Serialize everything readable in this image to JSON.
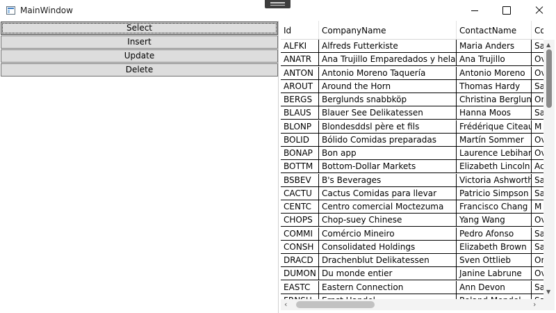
{
  "window": {
    "title": "MainWindow"
  },
  "buttons": [
    {
      "label": "Select"
    },
    {
      "label": "Insert"
    },
    {
      "label": "Update"
    },
    {
      "label": "Delete"
    }
  ],
  "grid": {
    "columns": [
      "Id",
      "CompanyName",
      "ContactName",
      "Co"
    ],
    "rows": [
      [
        "ALFKI",
        "Alfreds Futterkiste",
        "Maria Anders",
        "Sa"
      ],
      [
        "ANATR",
        "Ana Trujillo Emparedados y helados",
        "Ana Trujillo",
        "Ov"
      ],
      [
        "ANTON",
        "Antonio Moreno Taquería",
        "Antonio Moreno",
        "Ov"
      ],
      [
        "AROUT",
        "Around the Horn",
        "Thomas Hardy",
        "Sa"
      ],
      [
        "BERGS",
        "Berglunds snabbköp",
        "Christina Berglund",
        "Or"
      ],
      [
        "BLAUS",
        "Blauer See Delikatessen",
        "Hanna Moos",
        "Sa"
      ],
      [
        "BLONP",
        "Blondesddsl père et fils",
        "Frédérique Citeaux",
        "M"
      ],
      [
        "BOLID",
        "Bólido Comidas preparadas",
        "Martín Sommer",
        "Ov"
      ],
      [
        "BONAP",
        "Bon app",
        "Laurence Lebihan",
        "Ov"
      ],
      [
        "BOTTM",
        "Bottom-Dollar Markets",
        "Elizabeth Lincoln",
        "Ac"
      ],
      [
        "BSBEV",
        "B's Beverages",
        "Victoria Ashworth",
        "Sa"
      ],
      [
        "CACTU",
        "Cactus Comidas para llevar",
        "Patricio Simpson",
        "Sa"
      ],
      [
        "CENTC",
        "Centro comercial Moctezuma",
        "Francisco Chang",
        "M"
      ],
      [
        "CHOPS",
        "Chop-suey Chinese",
        "Yang Wang",
        "Ov"
      ],
      [
        "COMMI",
        "Comércio Mineiro",
        "Pedro Afonso",
        "Sa"
      ],
      [
        "CONSH",
        "Consolidated Holdings",
        "Elizabeth Brown",
        "Sa"
      ],
      [
        "DRACD",
        "Drachenblut Delikatessen",
        "Sven Ottlieb",
        "Or"
      ],
      [
        "DUMON",
        "Du monde entier",
        "Janine Labrune",
        "Ov"
      ],
      [
        "EASTC",
        "Eastern Connection",
        "Ann Devon",
        "Sa"
      ],
      [
        "FRNSH",
        "Ernst Handel",
        "Roland Mendel",
        "Sa"
      ]
    ]
  },
  "icons": {
    "app": "app-window-icon",
    "minimize": "minimize-icon",
    "maximize": "maximize-icon",
    "close": "close-icon"
  }
}
